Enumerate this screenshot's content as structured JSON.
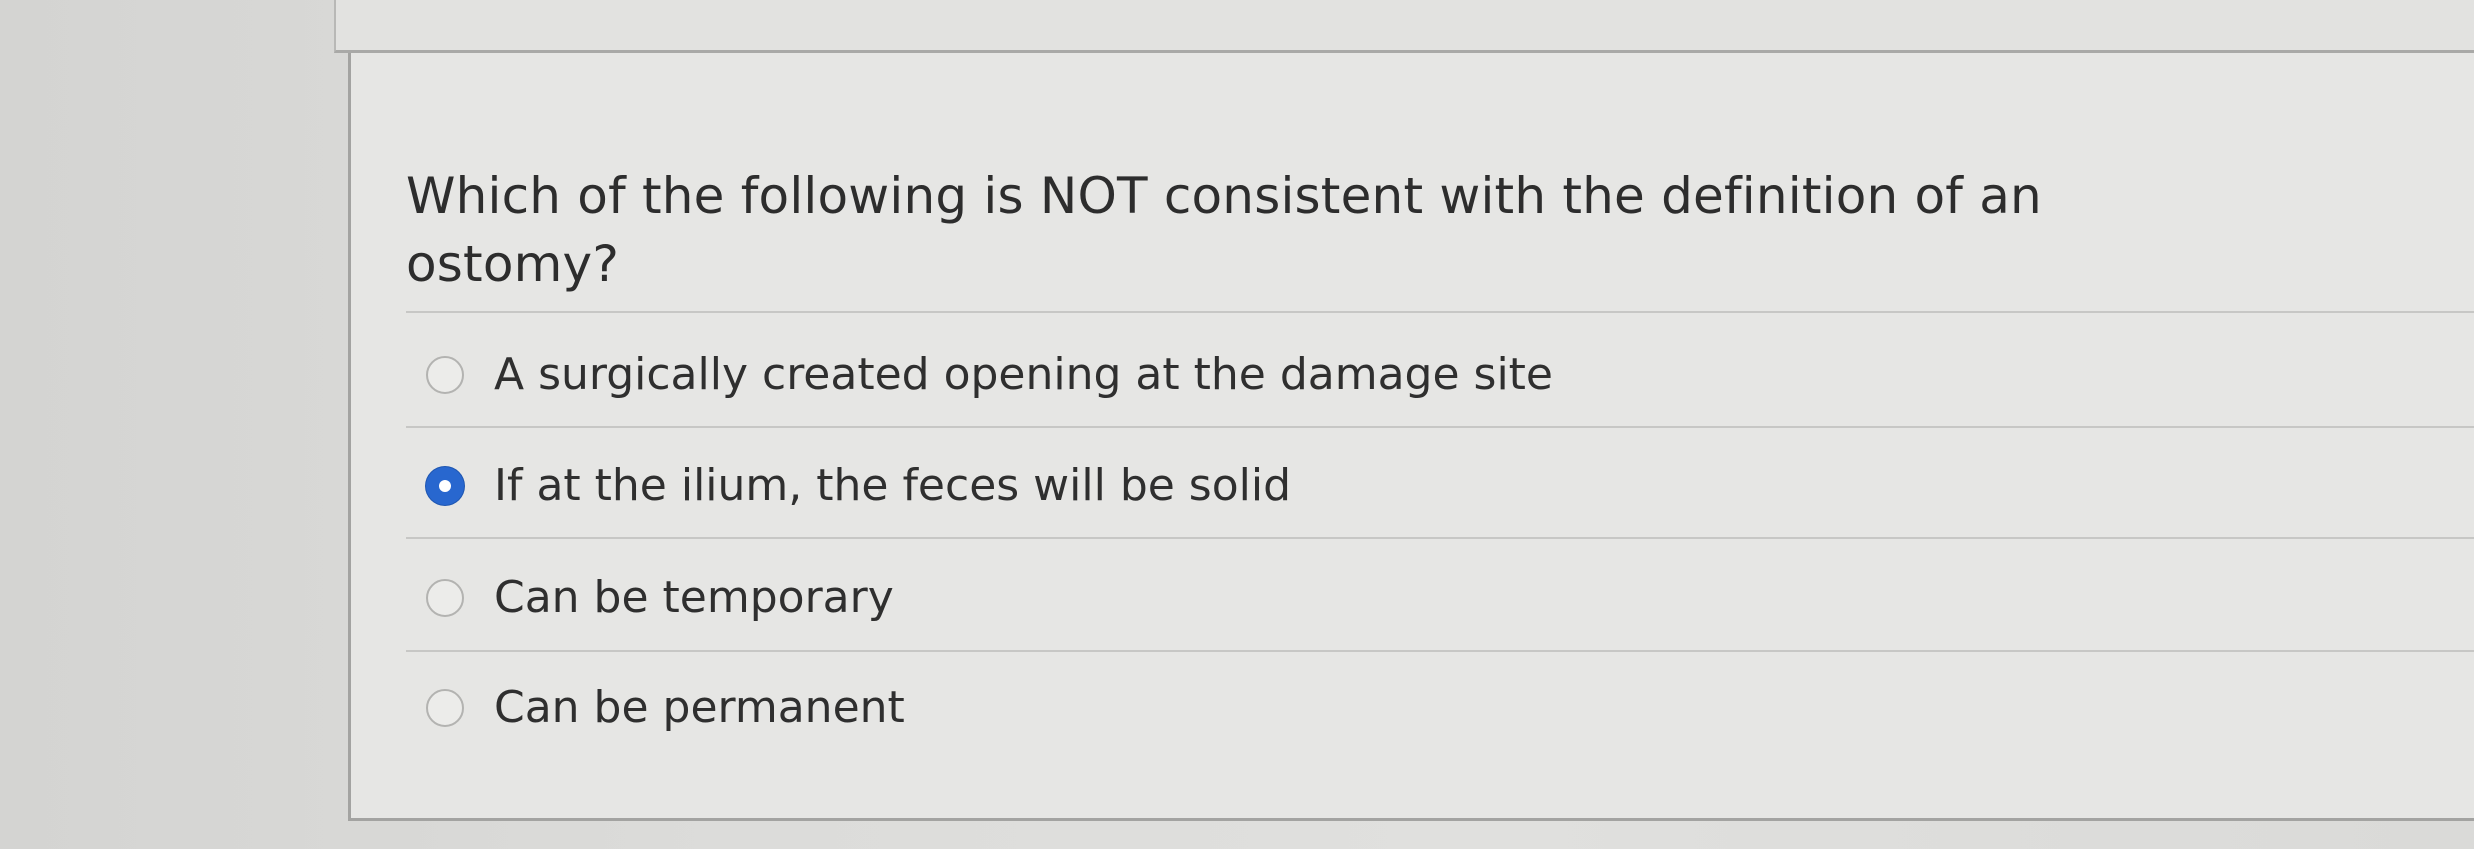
{
  "question": {
    "text": "Which of the following is NOT consistent with the definition of an ostomy?"
  },
  "answers": [
    {
      "label": "A surgically created opening at the damage site",
      "selected": false
    },
    {
      "label": "If at the ilium, the feces will be solid",
      "selected": true
    },
    {
      "label": "Can be temporary",
      "selected": false
    },
    {
      "label": "Can be permanent",
      "selected": false
    }
  ],
  "colors": {
    "selected_radio": "#2867cf"
  }
}
